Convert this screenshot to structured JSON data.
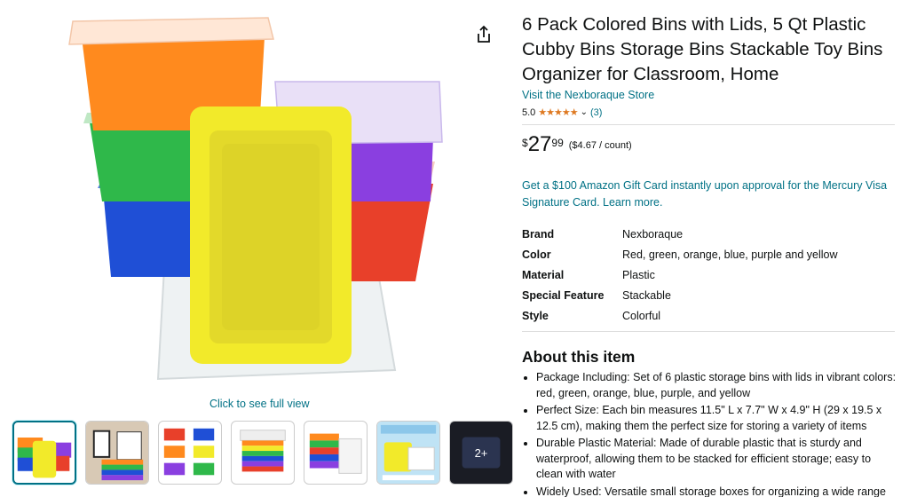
{
  "product": {
    "title": "6 Pack Colored Bins with Lids, 5 Qt Plastic Cubby Bins Storage Bins Stackable Toy Bins Organizer for Classroom, Home",
    "store_link": "Visit the Nexboraque Store",
    "rating_value": "5.0",
    "stars": "★★★★★",
    "rating_count": "(3)",
    "price_symbol": "$",
    "price_whole": "27",
    "price_fraction": "99",
    "price_per_unit": "($4.67 / count)",
    "promo": "Get a $100 Amazon Gift Card instantly upon approval for the Mercury Visa Signature Card. Learn more."
  },
  "gallery": {
    "full_view_label": "Click to see full view",
    "more_label": "2+"
  },
  "specs": [
    {
      "key": "Brand",
      "value": "Nexboraque"
    },
    {
      "key": "Color",
      "value": "Red, green, orange, blue, purple and yellow"
    },
    {
      "key": "Material",
      "value": "Plastic"
    },
    {
      "key": "Special Feature",
      "value": "Stackable"
    },
    {
      "key": "Style",
      "value": "Colorful"
    }
  ],
  "about": {
    "heading": "About this item",
    "bullets": [
      "Package Including: Set of 6 plastic storage bins with lids in vibrant colors: red, green, orange, blue, purple, and yellow",
      "Perfect Size: Each bin measures 11.5\" L x 7.7\" W x 4.9\" H (29 x 19.5 x 12.5 cm), making them the perfect size for storing a variety of items",
      "Durable Plastic Material: Made of durable plastic that is sturdy and waterproof, allowing them to be stacked for efficient storage; easy to clean with water",
      "Widely Used: Versatile small storage boxes for organizing a wide range of items such as toys, crafts, art supplies, books, clothes, office supplies"
    ]
  },
  "icons": {
    "share": "share-icon",
    "chevron": "chevron-down-icon"
  },
  "colors": {
    "link": "#007185",
    "star": "#de7921",
    "bin_orange": "#ff8a1e",
    "bin_green": "#2fb84a",
    "bin_blue": "#1f4fd6",
    "bin_purple": "#8a3fe0",
    "bin_red": "#e8402a",
    "bin_yellow": "#f2ea2a"
  }
}
